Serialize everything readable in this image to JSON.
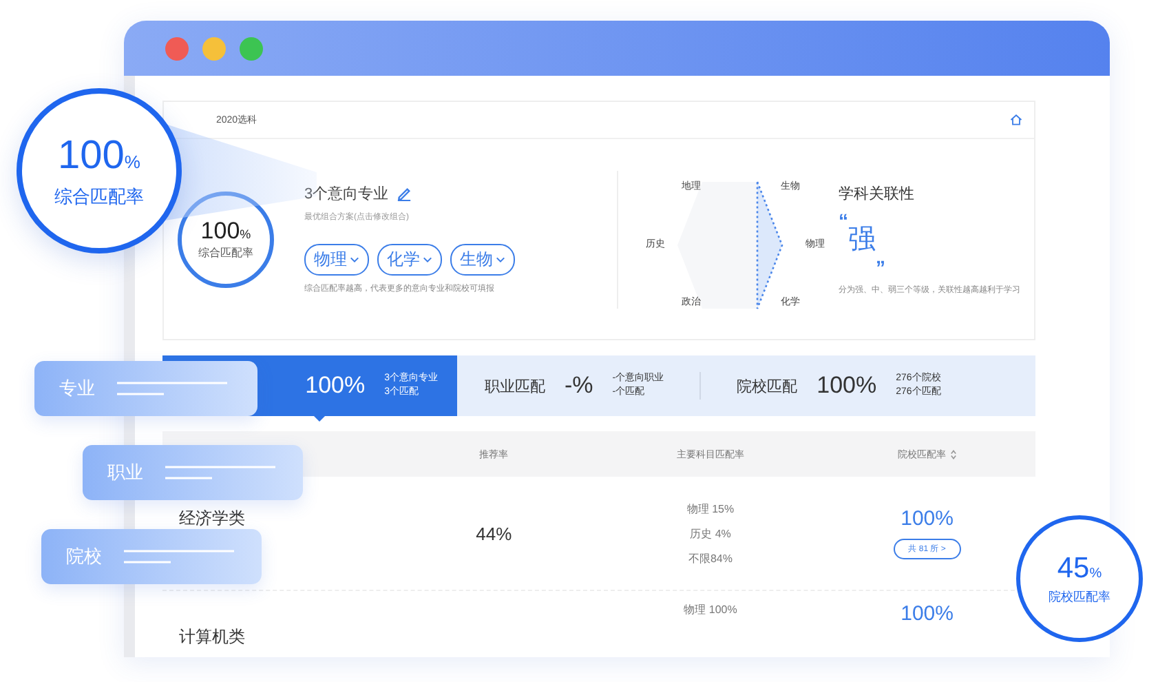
{
  "card": {
    "header": "2020选科",
    "overall": {
      "value": "100",
      "unit": "%",
      "label": "综合匹配率"
    },
    "title": "3个意向专业",
    "subtitle": "最优组合方案(点击修改组合)",
    "subjects": [
      "物理",
      "化学",
      "生物"
    ],
    "note": "综合匹配率越高，代表更多的意向专业和院校可填报",
    "hexagon_labels": [
      "地理",
      "生物",
      "历史",
      "物理",
      "政治",
      "化学"
    ],
    "relevance": {
      "title": "学科关联性",
      "open_quote": "“",
      "value": "强",
      "close_quote": "”",
      "description": "分为强、中、弱三个等级，关联性越高越利于学习"
    }
  },
  "tabs": [
    {
      "value": "100%",
      "lines": [
        "3个意向专业",
        "3个匹配"
      ],
      "selected": true
    },
    {
      "label": "职业匹配",
      "value": "-%",
      "lines": [
        "-个意向职业",
        "-个匹配"
      ],
      "selected": false
    },
    {
      "label": "院校匹配",
      "value": "100%",
      "lines": [
        "276个院校",
        "276个匹配"
      ],
      "selected": false
    }
  ],
  "table": {
    "columns": [
      {
        "label": "推荐率",
        "sortable": false
      },
      {
        "label": "主要科目匹配率",
        "sortable": false
      },
      {
        "label": "院校匹配率",
        "sortable": true
      }
    ],
    "rows": [
      {
        "name": "经济学类",
        "rate": "44%",
        "subjects": [
          "物理 15%",
          "历史 4%",
          "不限84%"
        ],
        "school_rate": "100%",
        "school_count": "共 81 所 >"
      },
      {
        "name": "计算机类",
        "subjects": [
          "物理 100%"
        ],
        "school_rate": "100%"
      }
    ]
  },
  "callouts": [
    {
      "label": "专业"
    },
    {
      "label": "职业"
    },
    {
      "label": "院校"
    }
  ],
  "callout_ring": {
    "value": "100",
    "unit": "%",
    "label": "综合匹配率"
  },
  "badge": {
    "value": "45",
    "unit": "%",
    "label": "院校匹配率"
  }
}
